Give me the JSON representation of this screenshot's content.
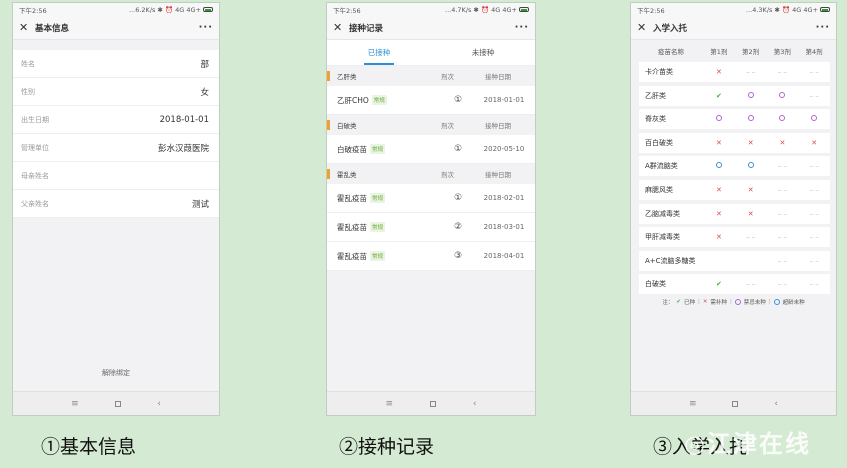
{
  "status": {
    "p1": {
      "time": "下午2:56",
      "right": "...6.2K/s ✱ ⏰ 4G 4G+"
    },
    "p2": {
      "time": "下午2:56",
      "right": "...4.7K/s ✱ ⏰ 4G 4G+"
    },
    "p3": {
      "time": "下午2:56",
      "right": "...4.3K/s ✱ ⏰ 4G 4G+"
    }
  },
  "phone1": {
    "title": "基本信息",
    "rows": [
      {
        "label": "姓名",
        "value": "部"
      },
      {
        "label": "性别",
        "value": "女"
      },
      {
        "label": "出生日期",
        "value": "2018-01-01"
      },
      {
        "label": "管理单位",
        "value": "彭水汉葭医院"
      },
      {
        "label": "母亲姓名",
        "value": ""
      },
      {
        "label": "父亲姓名",
        "value": "测试"
      }
    ],
    "unbind": "解除绑定"
  },
  "phone2": {
    "title": "接种记录",
    "tabs": [
      "已接种",
      "未接种"
    ],
    "groups": [
      {
        "name": "乙肝类",
        "dose_header": "剂次",
        "date_header": "接种日期",
        "items": [
          {
            "name": "乙肝CHO",
            "tag": "常规",
            "dose": "①",
            "date": "2018-01-01"
          }
        ]
      },
      {
        "name": "白破类",
        "dose_header": "剂次",
        "date_header": "接种日期",
        "items": [
          {
            "name": "白破疫苗",
            "tag": "常规",
            "dose": "①",
            "date": "2020-05-10"
          }
        ]
      },
      {
        "name": "霍乱类",
        "dose_header": "剂次",
        "date_header": "接种日期",
        "items": [
          {
            "name": "霍乱疫苗",
            "tag": "常规",
            "dose": "①",
            "date": "2018-02-01"
          },
          {
            "name": "霍乱疫苗",
            "tag": "常规",
            "dose": "②",
            "date": "2018-03-01"
          },
          {
            "name": "霍乱疫苗",
            "tag": "常规",
            "dose": "③",
            "date": "2018-04-01"
          }
        ]
      }
    ]
  },
  "phone3": {
    "title": "入学入托",
    "headers": [
      "疫苗名称",
      "第1剂",
      "第2剂",
      "第3剂",
      "第4剂"
    ],
    "rows": [
      {
        "name": "卡介苗类",
        "cells": [
          "x",
          "-",
          "-",
          "-"
        ]
      },
      {
        "name": "乙肝类",
        "cells": [
          "ok",
          "p",
          "p",
          "-"
        ]
      },
      {
        "name": "脊灰类",
        "cells": [
          "p",
          "p",
          "p",
          "p"
        ]
      },
      {
        "name": "百白破类",
        "cells": [
          "x",
          "x",
          "x",
          "x"
        ]
      },
      {
        "name": "A群流脑类",
        "cells": [
          "b",
          "b",
          "-",
          "-"
        ]
      },
      {
        "name": "麻腮风类",
        "cells": [
          "x",
          "x",
          "-",
          "-"
        ]
      },
      {
        "name": "乙脑减毒类",
        "cells": [
          "x",
          "x",
          "-",
          "-"
        ]
      },
      {
        "name": "甲肝减毒类",
        "cells": [
          "x",
          "-",
          "-",
          "-"
        ]
      },
      {
        "name": "A+C流脑多糖类",
        "cells": [
          "",
          "",
          "-",
          "-"
        ]
      },
      {
        "name": "白破类",
        "cells": [
          "ok",
          "-",
          "-",
          "-"
        ]
      }
    ],
    "legend": {
      "prefix": "注：",
      "done": "已种",
      "need": "需补种",
      "later": "禁忌未种",
      "delayed": "超龄未种"
    }
  },
  "captions": [
    "①基本信息",
    "②接种记录",
    "③入学入托"
  ],
  "watermark": "◎江津在线",
  "colors": {
    "accent": "#2d8fd6",
    "tag": "#6ca83a",
    "cross": "#e2484a",
    "check": "#46b23d",
    "purple": "#b063d6",
    "blue": "#3c8fd8",
    "bg": "#d5ead2"
  }
}
